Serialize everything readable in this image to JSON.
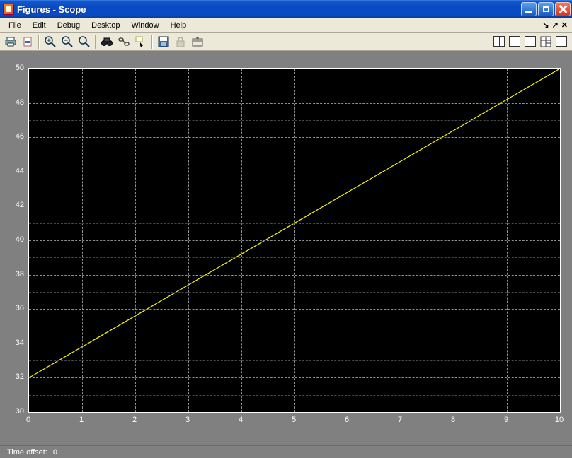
{
  "window": {
    "title": "Figures - Scope"
  },
  "menu": {
    "items": [
      "File",
      "Edit",
      "Debug",
      "Desktop",
      "Window",
      "Help"
    ],
    "dock_controls": {
      "minimize": "↘",
      "restore": "↗",
      "close": "✕"
    }
  },
  "toolbar": {
    "print": "print",
    "copy": "copy",
    "zoom_in": "zoom-in",
    "zoom_out": "zoom-out",
    "zoom_reset": "zoom-reset",
    "find": "find",
    "link": "link",
    "data_cursor": "data-cursor",
    "save": "save",
    "lock": "lock",
    "docking": "docking",
    "layout_2x2": "2x2",
    "layout_1x2": "1x2",
    "layout_2x1": "2x1",
    "layout_custom": "custom",
    "layout_single": "single"
  },
  "statusbar": {
    "label": "Time offset:",
    "value": "0"
  },
  "chart_data": {
    "type": "line",
    "title": "",
    "xlabel": "",
    "ylabel": "",
    "x": [
      0,
      1,
      2,
      3,
      4,
      5,
      6,
      7,
      8,
      9,
      10
    ],
    "values": [
      32,
      33.8,
      35.6,
      37.4,
      39.2,
      41,
      42.8,
      44.6,
      46.4,
      48.2,
      50
    ],
    "xlim": [
      0,
      10
    ],
    "ylim": [
      30,
      50
    ],
    "xticks": [
      0,
      1,
      2,
      3,
      4,
      5,
      6,
      7,
      8,
      9,
      10
    ],
    "yticks": [
      30,
      32,
      34,
      36,
      38,
      40,
      42,
      44,
      46,
      48,
      50
    ],
    "line_color": "#f6f600",
    "background": "#000000",
    "grid": true
  }
}
